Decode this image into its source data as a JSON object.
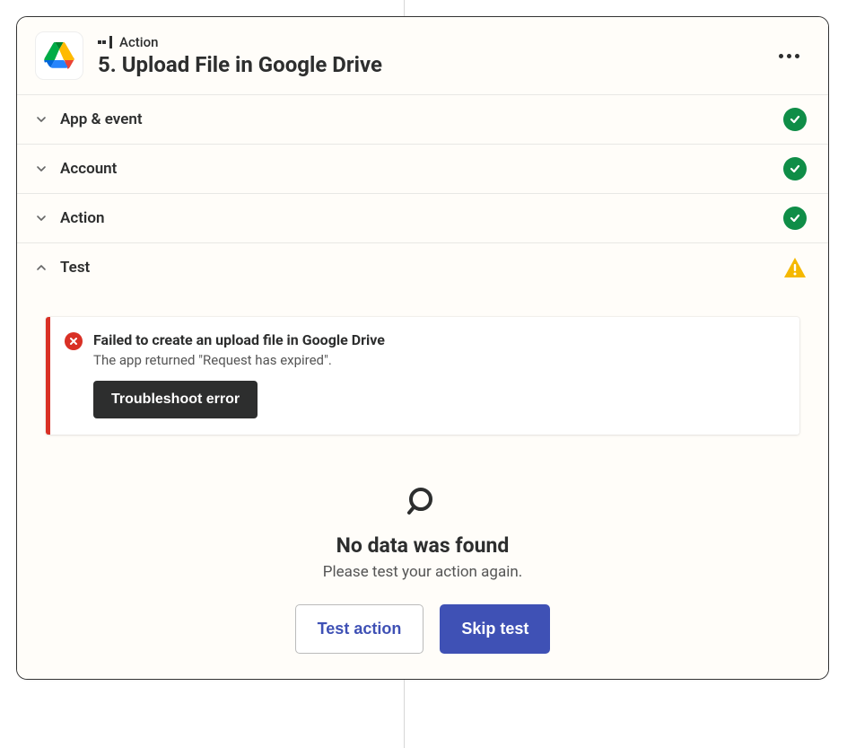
{
  "header": {
    "label": "Action",
    "title": "5. Upload File in Google Drive"
  },
  "sections": {
    "app_event": {
      "label": "App & event"
    },
    "account": {
      "label": "Account"
    },
    "action": {
      "label": "Action"
    },
    "test": {
      "label": "Test"
    }
  },
  "error": {
    "title": "Failed to create an upload file in Google Drive",
    "message": "The app returned \"Request has expired\".",
    "button": "Troubleshoot error"
  },
  "empty": {
    "title": "No data was found",
    "subtitle": "Please test your action again."
  },
  "buttons": {
    "test_action": "Test action",
    "skip_test": "Skip test"
  }
}
